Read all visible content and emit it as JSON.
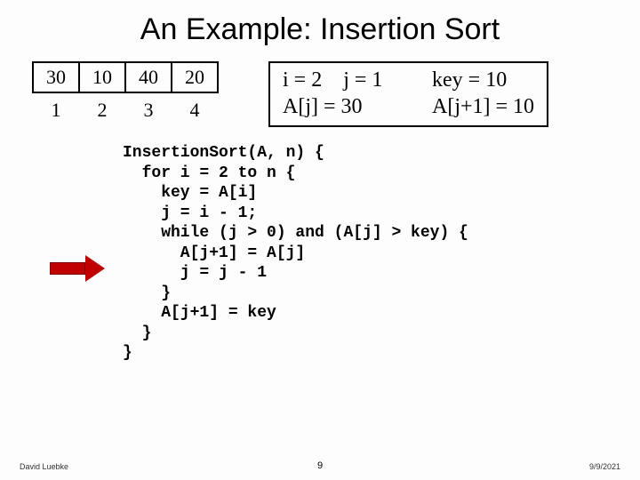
{
  "title": "An Example: Insertion Sort",
  "array": {
    "cells": [
      "30",
      "10",
      "40",
      "20"
    ],
    "indices": [
      "1",
      "2",
      "3",
      "4"
    ]
  },
  "state": {
    "i": "i = 2",
    "j": "j = 1",
    "key": "key = 10",
    "aj": "A[j] = 30",
    "aj1": "A[j+1] = 10"
  },
  "code": "InsertionSort(A, n) {\n  for i = 2 to n {\n    key = A[i]\n    j = i - 1;\n    while (j > 0) and (A[j] > key) {\n      A[j+1] = A[j]\n      j = j - 1\n    }\n    A[j+1] = key\n  }\n}",
  "footer": {
    "author": "David Luebke",
    "page": "9",
    "date": "9/9/2021"
  }
}
